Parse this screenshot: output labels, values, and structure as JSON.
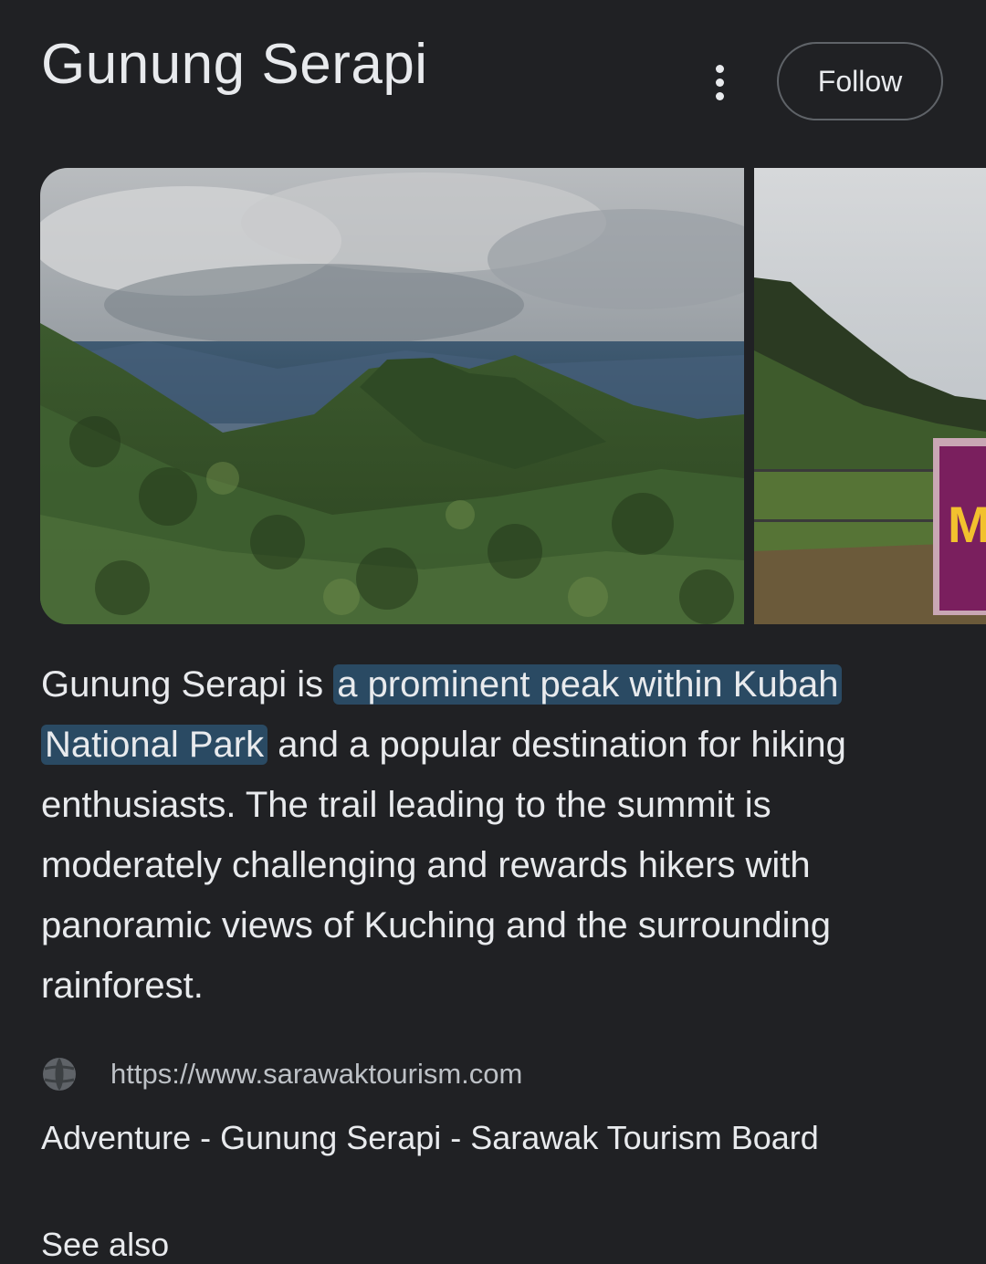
{
  "header": {
    "title": "Gunung Serapi",
    "follow_label": "Follow"
  },
  "images": [
    {
      "icon": "mountain-landscape-image"
    },
    {
      "icon": "park-sign-image",
      "sign_text": "M"
    }
  ],
  "description": {
    "before": "Gunung Serapi is ",
    "highlight1": "a prominent peak within Kubah",
    "highlight2": "National Park",
    "after": " and a popular destination for hiking enthusiasts. The trail leading to the summit is moderately challenging and rewards hikers with panoramic views of Kuching and the surrounding rainforest."
  },
  "source": {
    "icon": "globe-icon",
    "url": "https://www.sarawaktourism.com",
    "title": "Adventure - Gunung Serapi - Sarawak Tourism Board"
  },
  "see_also": {
    "label": "See also"
  },
  "colors": {
    "background": "#202124",
    "highlight": "#2a4a63",
    "text": "#e8eaed"
  }
}
